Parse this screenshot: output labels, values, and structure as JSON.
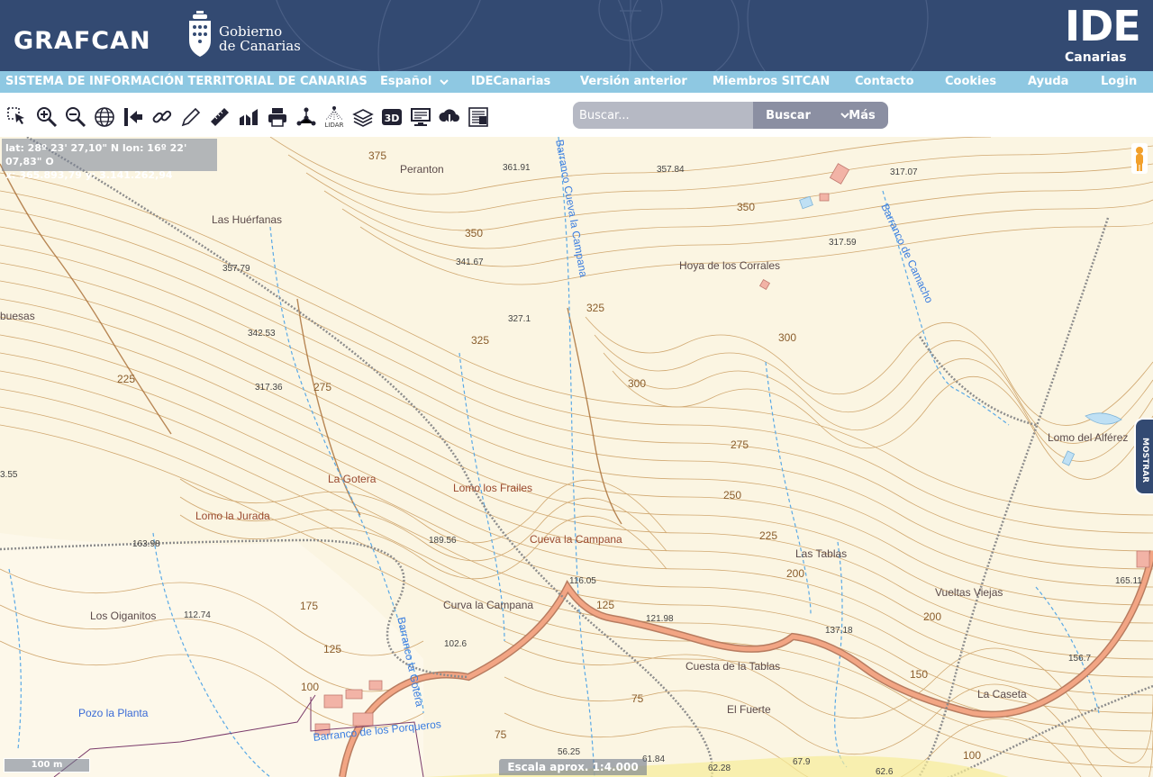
{
  "header": {
    "brand": "GRAFCAN",
    "gobierno_line1": "Gobierno",
    "gobierno_line2": "de Canarias",
    "ide_big": "IDE",
    "ide_small": "Canarias",
    "bg_color": "#334a72"
  },
  "navbar": {
    "title": "SISTEMA DE INFORMACIÓN TERRITORIAL DE CANARIAS",
    "language": "Español",
    "items": [
      "IDECanarias",
      "Versión anterior",
      "Miembros SITCAN",
      "Contacto",
      "Cookies",
      "Ayuda",
      "Login"
    ],
    "bg_color": "#8ec8e2"
  },
  "toolbar": {
    "tools": [
      "select-icon",
      "zoom-in-icon",
      "zoom-out-icon",
      "globe-icon",
      "exit-icon",
      "link-icon",
      "pencil-icon",
      "ruler-icon",
      "profile-chart-icon",
      "print-icon",
      "network-icon",
      "lidar-icon",
      "layers-icon",
      "3d-icon",
      "monitor-icon",
      "cloud-download-icon",
      "document-icon"
    ],
    "lidar_label": "LIDAR"
  },
  "search": {
    "placeholder": "Buscar...",
    "button": "Buscar",
    "more": "Más"
  },
  "map": {
    "coords_line1": "lat: 28º 23' 27,10\" N  lon: 16º 22' 07,83\" O",
    "coords_line2": "x: 365.893,79  y: 3.141.262,94",
    "scalebar": "100 m",
    "scale_text": "Escala aprox. 1:4.000",
    "mostrar": "MOSTRAR",
    "places": {
      "peranton": "Peranton",
      "las_huerfanas": "Las Huérfanas",
      "hoya_corrales": "Hoya de los Corrales",
      "la_gotera": "La Gotera",
      "lomo_frailes": "Lomo los Frailes",
      "lomo_jurada": "Lomo la Jurada",
      "cueva_campana": "Cueva la Campana",
      "curva_campana": "Curva la Campana",
      "los_oiganitos": "Los Oiganitos",
      "pozo_planta": "Pozo la Planta",
      "las_tablas": "Las Tablas",
      "vueltas_viejas": "Vueltas Viejas",
      "cuesta_tablas": "Cuesta de la Tablas",
      "el_fuerte": "El Fuerte",
      "la_caseta": "La Caseta",
      "lomo_alferez": "Lomo del Alférez",
      "buesas": "buesas"
    },
    "streams": {
      "cueva_campana": "Barranco Cueva la Campana",
      "camacho": "Barranco de Camacho",
      "gotera": "Barranco la Gotera",
      "porqueros": "Barranco de los Porqueros"
    },
    "spot_heights": [
      "361.91",
      "357.84",
      "317.07",
      "341.67",
      "357.79",
      "317.59",
      "327.1",
      "342.53",
      "317.36",
      "189.56",
      "163.98",
      "116.05",
      "112.74",
      "121.98",
      "137.18",
      "102.6",
      "156.7",
      "165.11",
      "56.25",
      "61.84",
      "62.28",
      "67.9",
      "62.6",
      "3.55"
    ],
    "contours": [
      "375",
      "350",
      "325",
      "300",
      "275",
      "250",
      "225",
      "200",
      "175",
      "150",
      "125",
      "100",
      "75"
    ]
  }
}
